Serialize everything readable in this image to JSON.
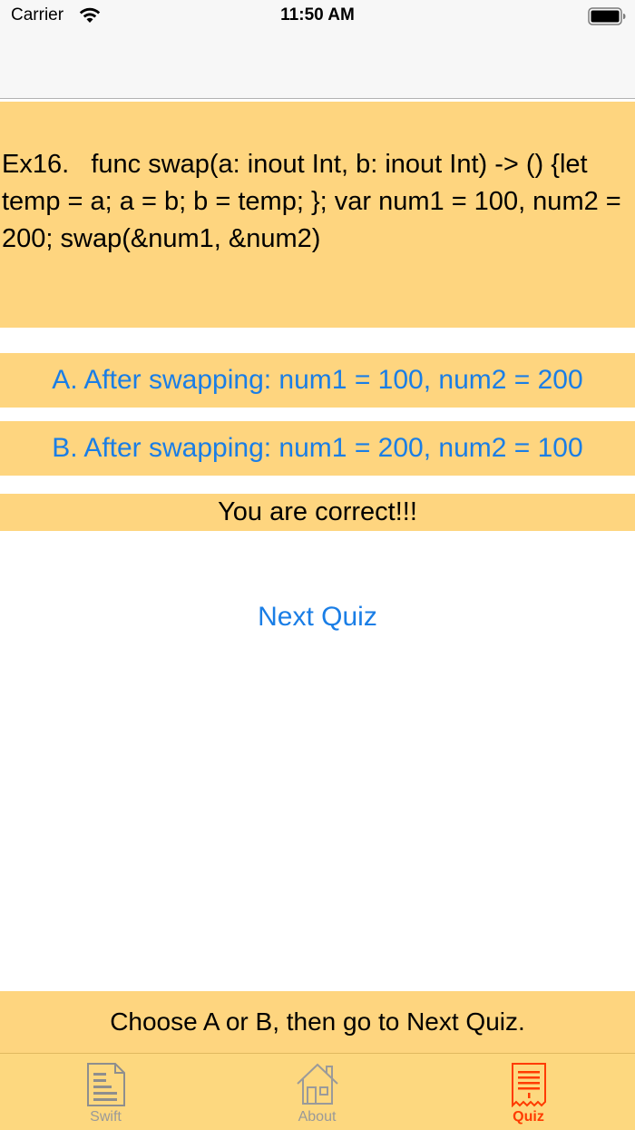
{
  "status_bar": {
    "carrier": "Carrier",
    "time": "11:50 AM"
  },
  "question": {
    "text": "Ex16.   func swap(a: inout Int, b: inout Int) -> () {let temp = a; a = b; b = temp; }; var num1 = 100, num2 = 200; swap(&num1, &num2)"
  },
  "answers": {
    "a": "A. After swapping: num1 = 100, num2 = 200",
    "b": "B. After swapping: num1 = 200, num2 = 100"
  },
  "feedback": "You are correct!!!",
  "next_quiz_label": "Next Quiz",
  "instruction": "Choose A or B, then go to Next Quiz.",
  "tabs": [
    {
      "label": "Swift",
      "icon": "document-icon",
      "active": false
    },
    {
      "label": "About",
      "icon": "house-icon",
      "active": false
    },
    {
      "label": "Quiz",
      "icon": "receipt-icon",
      "active": true
    }
  ],
  "colors": {
    "panel_background": "#fed57f",
    "link_blue": "#1a7ee6",
    "active_tab": "#ff3b00",
    "inactive_tab": "#999999"
  }
}
